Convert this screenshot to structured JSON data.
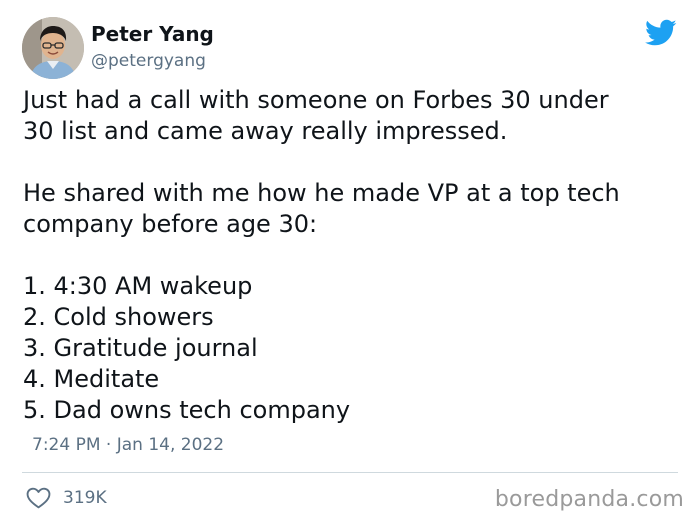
{
  "author": {
    "display_name": "Peter Yang",
    "handle": "@petergyang"
  },
  "icons": {
    "brand": "twitter-bird-icon",
    "like": "heart-icon",
    "brand_color": "#1da1f2"
  },
  "tweet": {
    "paragraphs": [
      {
        "lines": [
          "Just had a call with someone on Forbes 30 under",
          "30 list and came away really impressed."
        ]
      },
      {
        "lines": [
          "He shared with me how he made VP at a top tech",
          "company before age 30:"
        ]
      },
      {
        "lines": [
          "1. 4:30 AM wakeup",
          "2. Cold showers",
          "3. Gratitude journal",
          "4. Meditate",
          "5. Dad owns tech company"
        ]
      }
    ],
    "timestamp": "7:24 PM · Jan 14, 2022",
    "like_count": "319K"
  },
  "watermark": "boredpanda.com"
}
